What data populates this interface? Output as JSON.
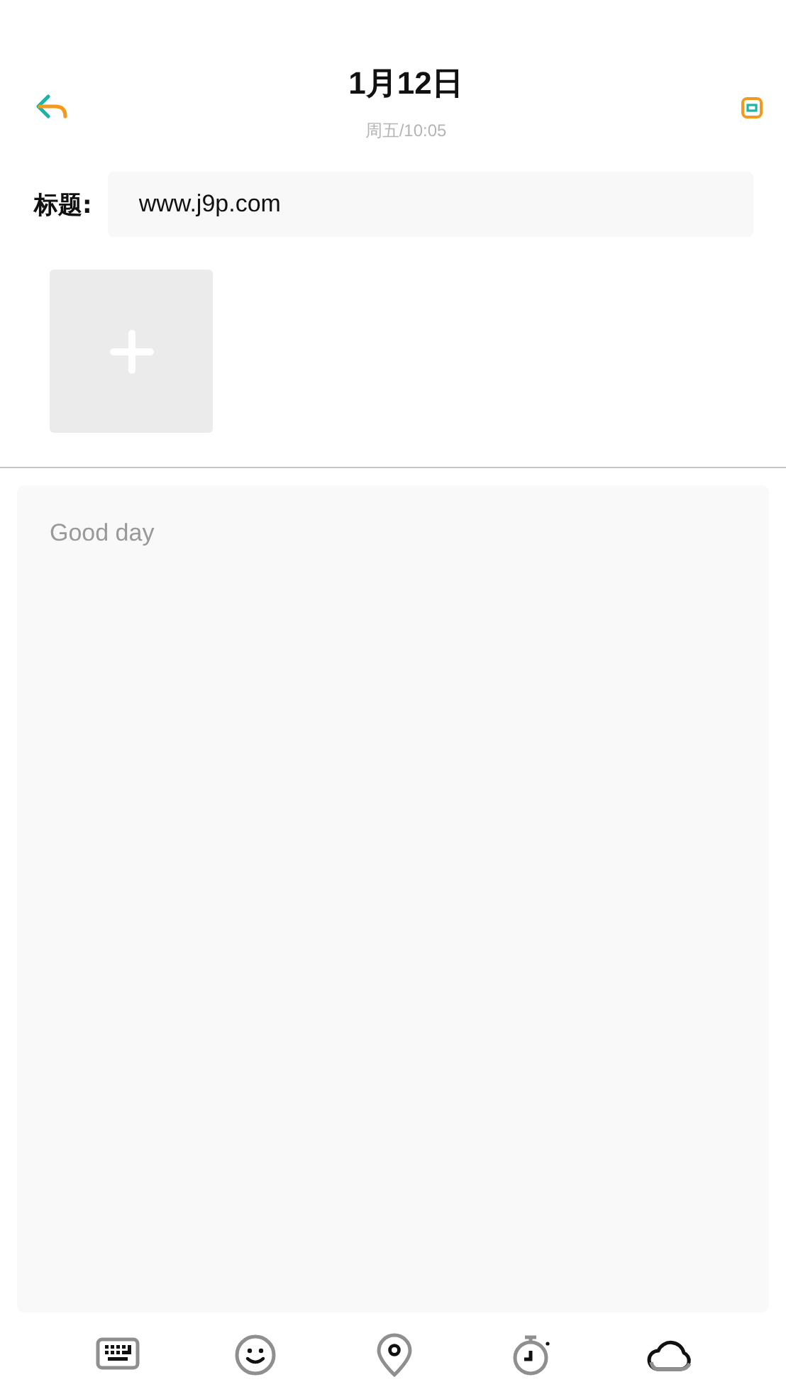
{
  "header": {
    "title": "1月12日",
    "subtitle": "周五/10:05"
  },
  "title_field": {
    "label": "标题:",
    "value": "www.j9p.com"
  },
  "body": {
    "placeholder": "Good day"
  },
  "toolbar": [
    {
      "kind": "keyboard"
    },
    {
      "kind": "emoji"
    },
    {
      "kind": "location"
    },
    {
      "kind": "timer"
    },
    {
      "kind": "cloud"
    }
  ]
}
